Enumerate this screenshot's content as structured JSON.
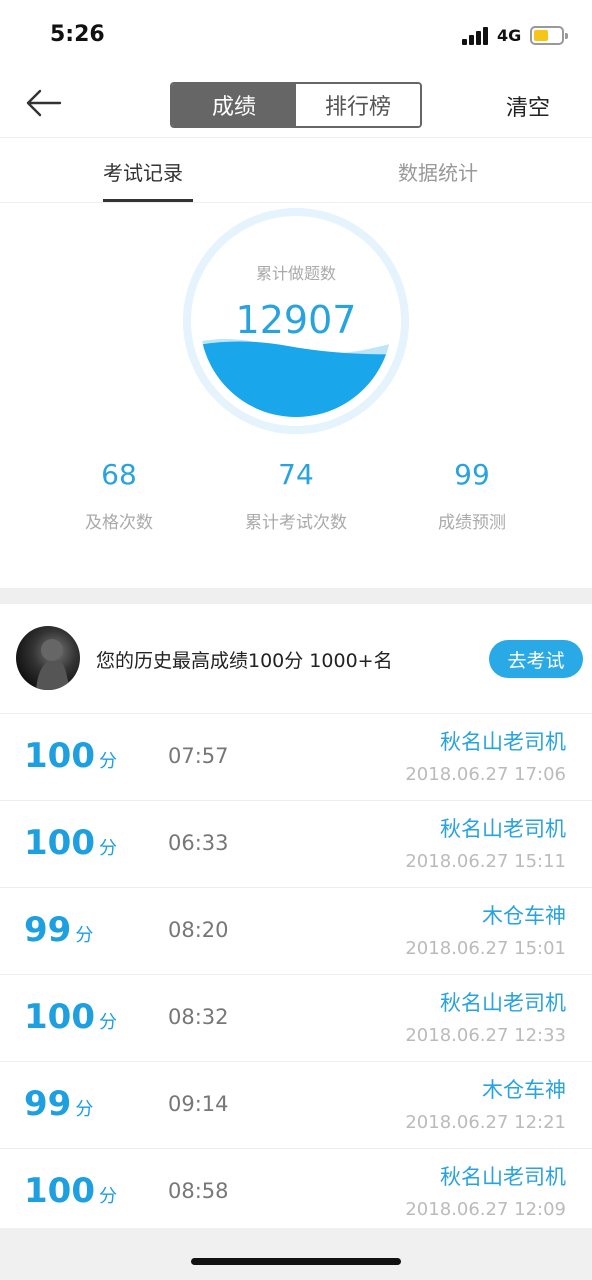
{
  "status_bar": {
    "time": "5:26",
    "network": "4G"
  },
  "nav": {
    "tab_score": "成绩",
    "tab_ranking": "排行榜",
    "clear_label": "清空"
  },
  "sub_tabs": {
    "exam_records": "考试记录",
    "data_stats": "数据统计"
  },
  "gauge": {
    "label": "累计做题数",
    "value": "12907",
    "fill_fraction": 0.35
  },
  "stats": [
    {
      "value": "68",
      "label": "及格次数"
    },
    {
      "value": "74",
      "label": "累计考试次数"
    },
    {
      "value": "99",
      "label": "成绩预测"
    }
  ],
  "best": {
    "text": "您的历史最高成绩100分  1000+名",
    "button": "去考试"
  },
  "records": [
    {
      "score": "100",
      "unit": "分",
      "duration": "07:57",
      "name": "秋名山老司机",
      "date": "2018.06.27 17:06"
    },
    {
      "score": "100",
      "unit": "分",
      "duration": "06:33",
      "name": "秋名山老司机",
      "date": "2018.06.27 15:11"
    },
    {
      "score": "99",
      "unit": "分",
      "duration": "08:20",
      "name": "木仓车神",
      "date": "2018.06.27 15:01"
    },
    {
      "score": "100",
      "unit": "分",
      "duration": "08:32",
      "name": "秋名山老司机",
      "date": "2018.06.27 12:33"
    },
    {
      "score": "99",
      "unit": "分",
      "duration": "09:14",
      "name": "木仓车神",
      "date": "2018.06.27 12:21"
    },
    {
      "score": "100",
      "unit": "分",
      "duration": "08:58",
      "name": "秋名山老司机",
      "date": "2018.06.27 12:09"
    }
  ],
  "colors": {
    "accent": "#29a3e0",
    "wave": "#1aa6ea",
    "button": "#29a9e6"
  }
}
